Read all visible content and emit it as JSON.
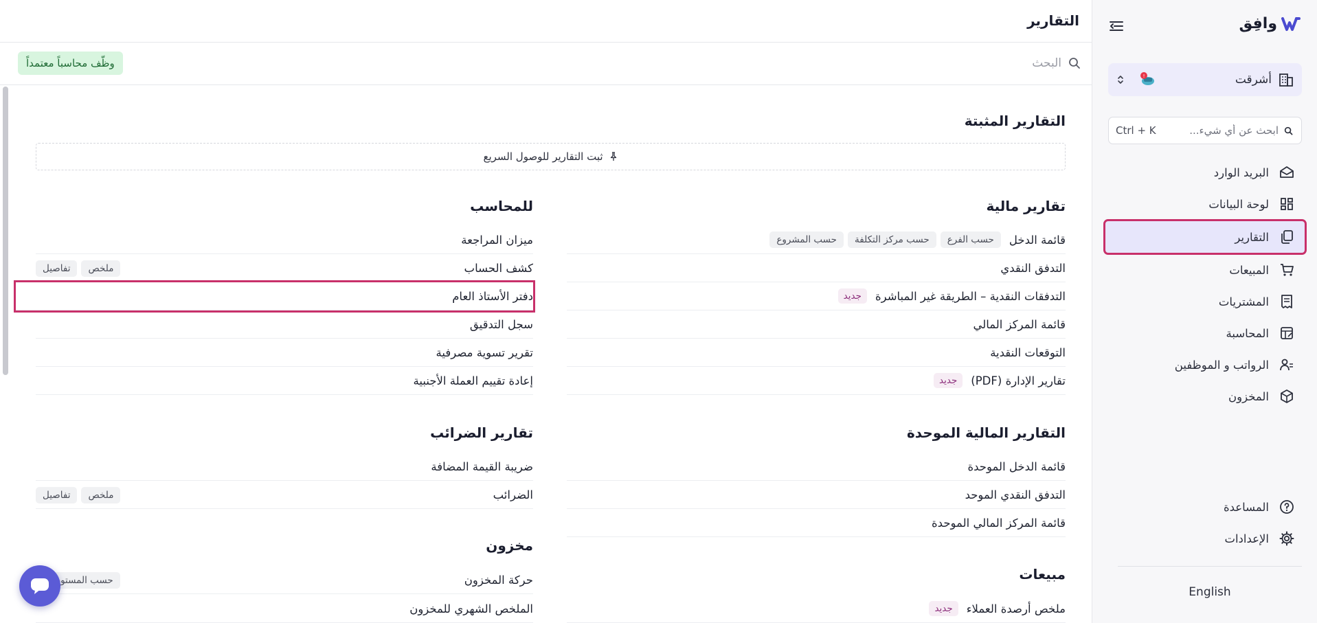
{
  "sidebar": {
    "logo_text": "وافِق",
    "org_name": "أشرقت",
    "search_placeholder": "ابحث عن أي شيء...",
    "search_shortcut": "Ctrl + K",
    "items": [
      {
        "label": "البريد الوارد",
        "icon": "inbox-icon"
      },
      {
        "label": "لوحة البيانات",
        "icon": "dashboard-icon"
      },
      {
        "label": "التقارير",
        "icon": "reports-icon",
        "active": true
      },
      {
        "label": "المبيعات",
        "icon": "cart-icon"
      },
      {
        "label": "المشتريات",
        "icon": "receipt-icon"
      },
      {
        "label": "المحاسبة",
        "icon": "ledger-icon"
      },
      {
        "label": "الرواتب و الموظفين",
        "icon": "users-icon"
      },
      {
        "label": "المخزون",
        "icon": "box-icon"
      }
    ],
    "bottom_items": [
      {
        "label": "المساعدة",
        "icon": "help-icon"
      },
      {
        "label": "الإعدادات",
        "icon": "gear-icon"
      }
    ],
    "language": "English"
  },
  "header": {
    "title": "التقارير",
    "search_placeholder": "البحث",
    "hire_badge": "وظّف محاسباً معتمداً"
  },
  "pinned": {
    "title": "التقارير المثبتة",
    "hint": "ثبت التقارير للوصول السريع"
  },
  "sections": {
    "financial": {
      "title": "تقارير مالية",
      "rows": [
        {
          "label": "قائمة الدخل",
          "chips": [
            "حسب الفرع",
            "حسب مركز التكلفة",
            "حسب المشروع"
          ]
        },
        {
          "label": "التدفق النقدي"
        },
        {
          "label": "التدفقات النقدية – الطريقة غير المباشرة",
          "new": "جديد"
        },
        {
          "label": "قائمة المركز المالي"
        },
        {
          "label": "التوقعات النقدية"
        },
        {
          "label": "تقارير الإدارة (PDF)",
          "new": "جديد"
        }
      ]
    },
    "consolidated": {
      "title": "التقارير المالية الموحدة",
      "rows": [
        {
          "label": "قائمة الدخل الموحدة"
        },
        {
          "label": "التدفق النقدي الموحد"
        },
        {
          "label": "قائمة المركز المالي الموحدة"
        }
      ]
    },
    "sales": {
      "title": "مبيعات",
      "rows": [
        {
          "label": "ملخص أرصدة العملاء",
          "new": "جديد"
        }
      ]
    },
    "accountant": {
      "title": "للمحاسب",
      "rows": [
        {
          "label": "ميزان المراجعة"
        },
        {
          "label": "كشف الحساب",
          "chips": [
            "ملخص",
            "تفاصيل"
          ]
        },
        {
          "label": "دفتر الأستاذ العام",
          "highlight": true
        },
        {
          "label": "سجل التدقيق"
        },
        {
          "label": "تقرير تسوية مصرفية"
        },
        {
          "label": "إعادة تقييم العملة الأجنبية"
        }
      ]
    },
    "tax": {
      "title": "تقارير الضرائب",
      "rows": [
        {
          "label": "ضريبة القيمة المضافة"
        },
        {
          "label": "الضرائب",
          "chips": [
            "ملخص",
            "تفاصيل"
          ]
        }
      ]
    },
    "inventory": {
      "title": "مخزون",
      "rows": [
        {
          "label": "حركة المخزون",
          "chips": [
            "حسب المستودع"
          ]
        },
        {
          "label": "الملخص الشهري للمخزون"
        }
      ]
    }
  },
  "colors": {
    "accent": "#5b5bd6",
    "highlight_border": "#c8306a",
    "active_bg": "#e7e6fb",
    "badge_green_bg": "#d8f5df",
    "new_badge": "#8b2c7a"
  }
}
